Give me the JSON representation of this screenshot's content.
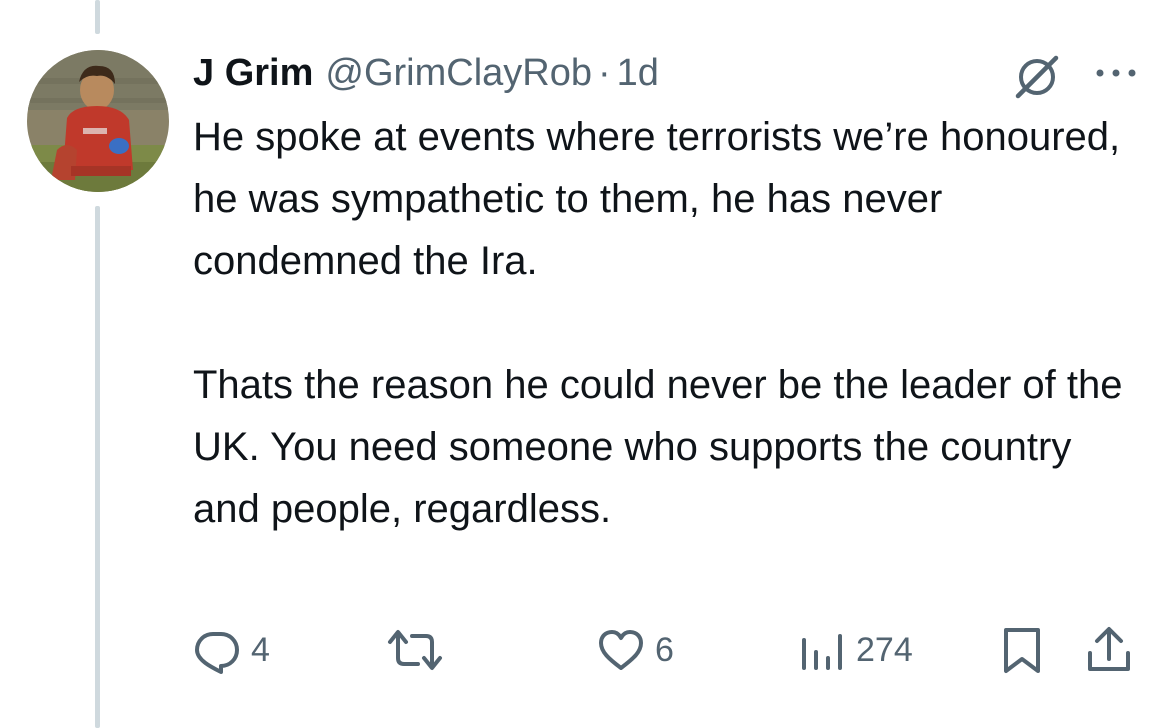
{
  "tweet": {
    "author": {
      "display_name": "J Grim",
      "handle": "@GrimClayRob",
      "separator": "·",
      "time": "1d"
    },
    "text_paragraphs": [
      "He spoke at events where terrorists we’re honoured, he was sympathetic to them, he has never condemned the Ira.",
      "Thats the reason he could never be the leader of the UK. You need someone who supports the country and people, regardless."
    ],
    "actions": {
      "replies": "4",
      "reposts": "",
      "likes": "6",
      "views": "274"
    }
  },
  "icons": {
    "grok": "grok-icon",
    "more": "more-options-icon",
    "reply": "reply-icon",
    "repost": "repost-icon",
    "like": "heart-icon",
    "views": "views-chart-icon",
    "bookmark": "bookmark-icon",
    "share": "share-icon"
  },
  "colors": {
    "text_primary": "#0f1419",
    "text_secondary": "#536471",
    "thread_line": "#cfd9de"
  }
}
